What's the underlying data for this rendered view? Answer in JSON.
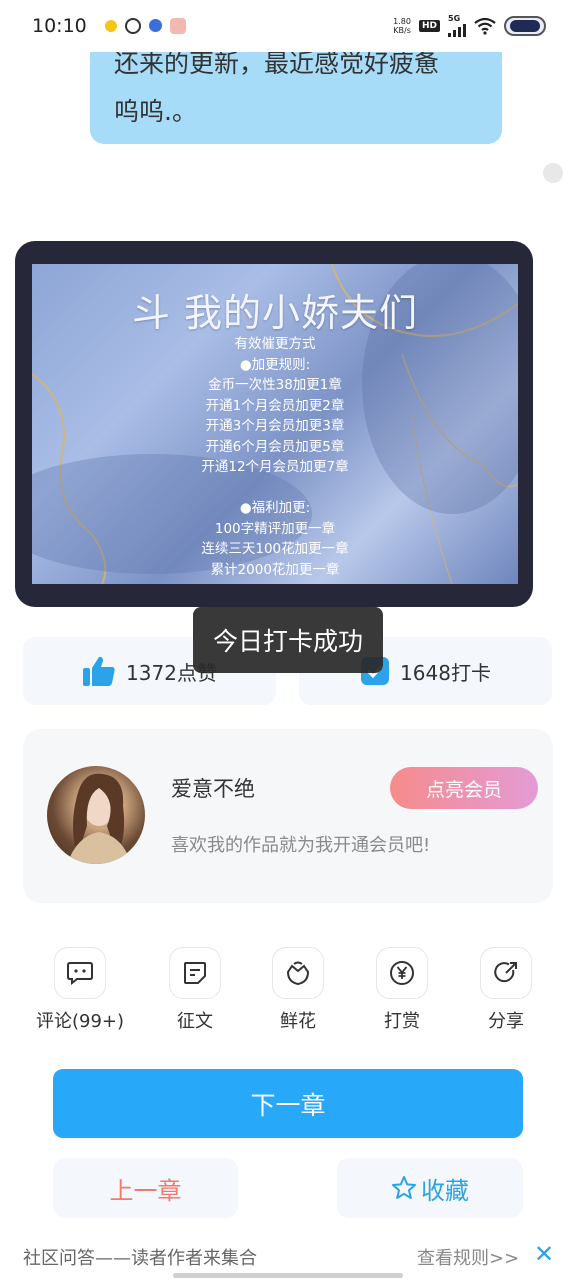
{
  "status_bar": {
    "time": "10:10",
    "net_speed_value": "1.80",
    "net_speed_unit": "KB/s",
    "hd_label": "HD",
    "network": "5G"
  },
  "comment_bubble": {
    "line1": "还来的更新，最近感觉好疲惫",
    "line2": "呜呜.。"
  },
  "chapter_image": {
    "title": "斗 我的小娇夫们",
    "lines": [
      "有效催更方式",
      "●加更规则:",
      "金币一次性38加更1章",
      "开通1个月会员加更2章",
      "开通3个月会员加更3章",
      "开通6个月会员加更5章",
      "开通12个月会员加更7章",
      "",
      "●福利加更:",
      "100字精评加更一章",
      "连续三天100花加更一章",
      "累计2000花加更一章"
    ]
  },
  "toast": {
    "text": "今日打卡成功"
  },
  "stats": {
    "like_label": "1372点赞",
    "checkin_label": "1648打卡",
    "like_color": "#2ba3e8",
    "checkin_color": "#2ba3e8"
  },
  "author": {
    "name": "爱意不绝",
    "description": "喜欢我的作品就为我开通会员吧!",
    "member_button": "点亮会员"
  },
  "actions": [
    {
      "label": "评论(99+)",
      "icon": "comment-icon"
    },
    {
      "label": "征文",
      "icon": "essay-icon"
    },
    {
      "label": "鲜花",
      "icon": "flower-icon"
    },
    {
      "label": "打赏",
      "icon": "yen-icon"
    },
    {
      "label": "分享",
      "icon": "share-icon"
    }
  ],
  "nav": {
    "next_label": "下一章",
    "prev_label": "上一章",
    "favorite_label": "收藏",
    "accent": "#27a8f8",
    "prev_color": "#f07b6b"
  },
  "bottom_bar": {
    "community_text": "社区问答——读者作者来集合",
    "rules_link": "查看规则>>",
    "close_glyph": "✕"
  }
}
